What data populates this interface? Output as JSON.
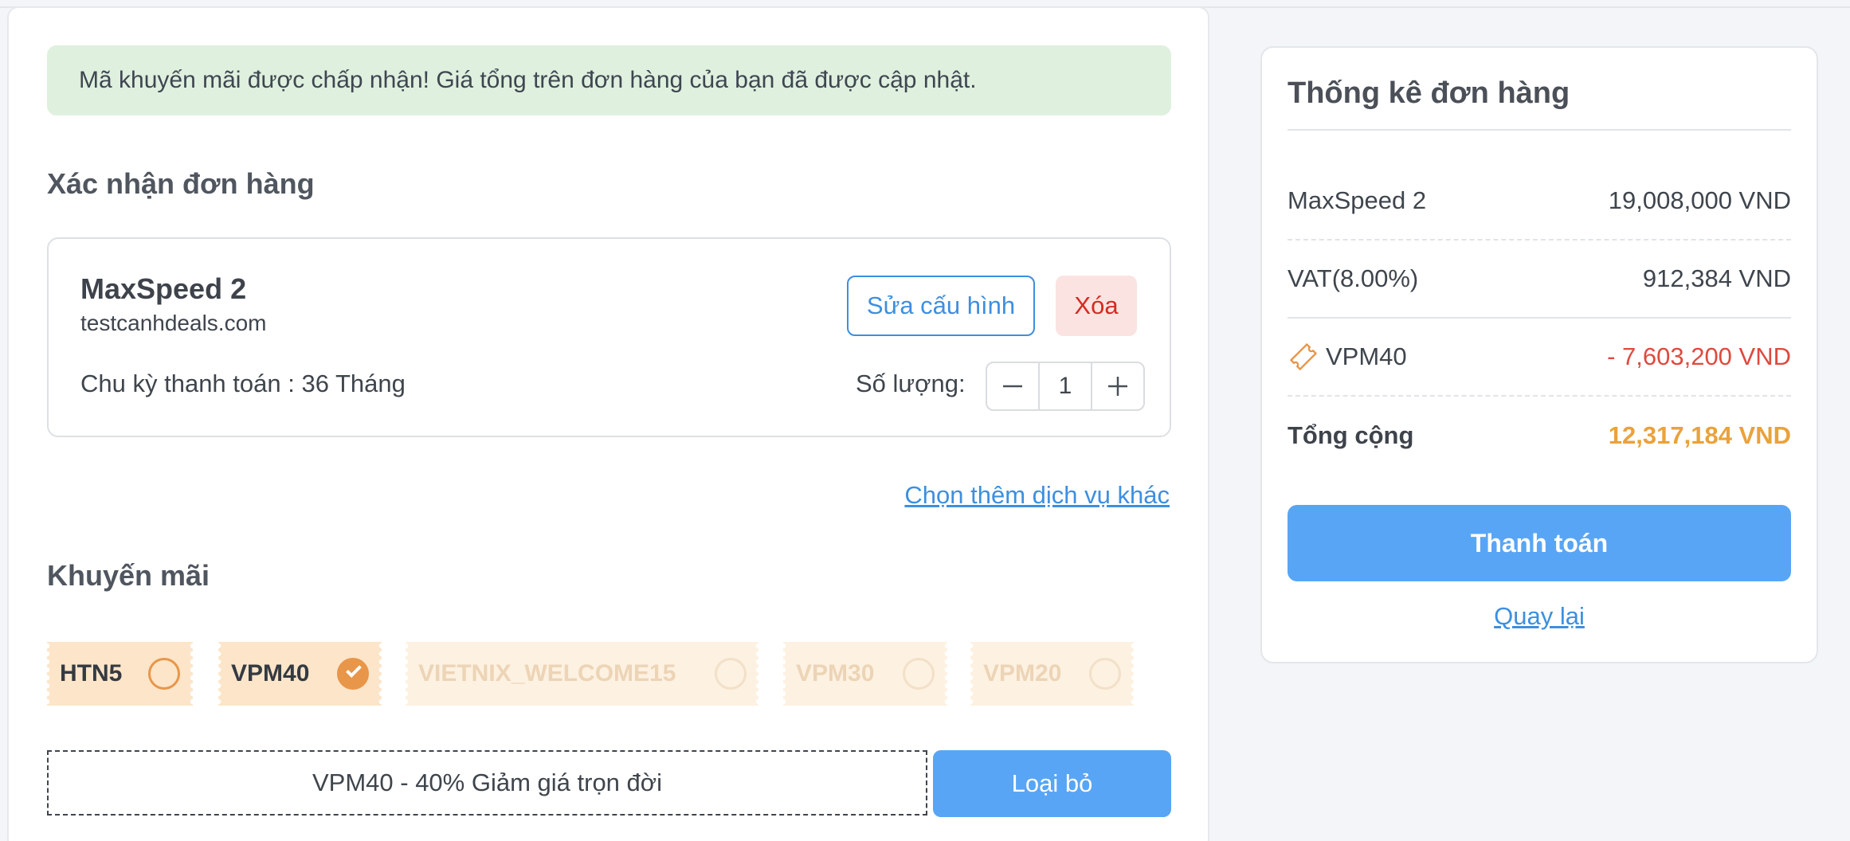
{
  "alert": {
    "message": "Mã khuyến mãi được chấp nhận! Giá tổng trên đơn hàng của bạn đã được cập nhật."
  },
  "confirm": {
    "title": "Xác nhận đơn hàng",
    "product": {
      "name": "MaxSpeed 2",
      "domain": "testcanhdeals.com",
      "cycle_label": "Chu kỳ thanh toán : 36 Tháng",
      "edit_label": "Sửa cấu hình",
      "delete_label": "Xóa",
      "quantity_label": "Số lượng:",
      "quantity": "1",
      "minus_icon": "minus-icon",
      "plus_icon": "plus-icon"
    },
    "more_services": "Chọn thêm dịch vụ khác"
  },
  "promo": {
    "title": "Khuyến mãi",
    "coupons": [
      {
        "code": "HTN5",
        "selected": false,
        "disabled": false
      },
      {
        "code": "VPM40",
        "selected": true,
        "disabled": false
      },
      {
        "code": "VIETNIX_WELCOME15",
        "selected": false,
        "disabled": true
      },
      {
        "code": "VPM30",
        "selected": false,
        "disabled": true
      },
      {
        "code": "VPM20",
        "selected": false,
        "disabled": true
      }
    ],
    "applied": "VPM40 - 40% Giảm giá trọn đời",
    "remove_label": "Loại bỏ"
  },
  "summary": {
    "title": "Thống kê đơn hàng",
    "rows": [
      {
        "label": "MaxSpeed 2",
        "value": "19,008,000 VND"
      },
      {
        "label": "VAT(8.00%)",
        "value": "912,384 VND"
      },
      {
        "label": "VPM40",
        "value": "- 7,603,200 VND",
        "icon": "coupon-tag-icon"
      },
      {
        "label": "Tổng cộng",
        "value": "12,317,184 VND"
      }
    ],
    "pay_label": "Thanh toán",
    "back_label": "Quay lại"
  },
  "colors": {
    "primary": "#59a5f5",
    "link": "#3d8fe0",
    "danger": "#d62a22",
    "discount": "#de4a3f",
    "total": "#eaa23a",
    "coupon_bg": "#fce5c9",
    "alert_bg": "#dff0df"
  }
}
